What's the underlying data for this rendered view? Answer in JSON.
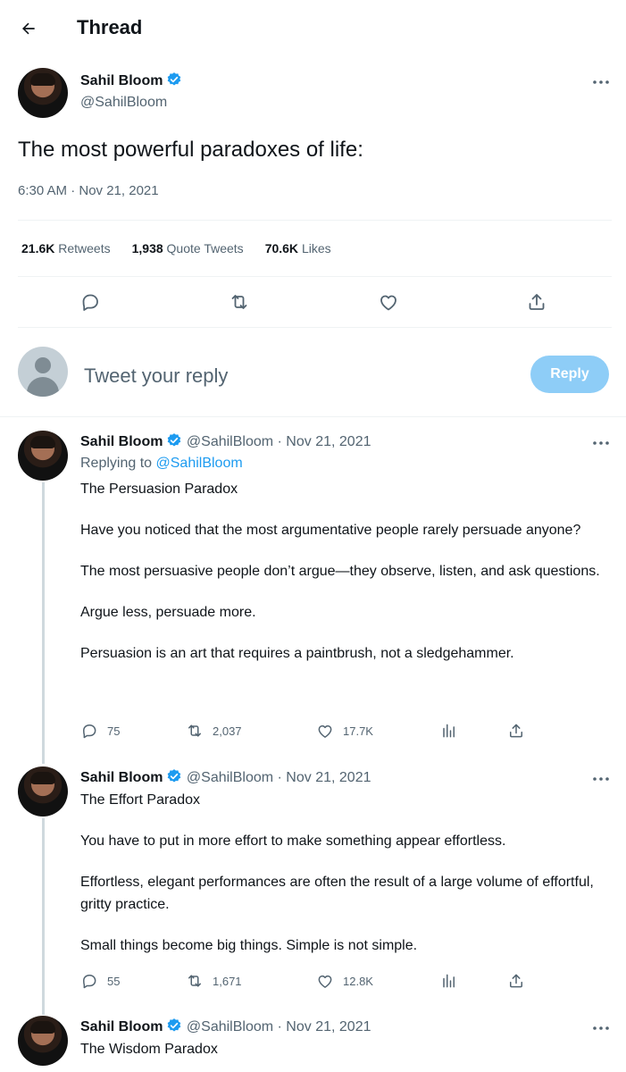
{
  "header": {
    "title": "Thread"
  },
  "main_tweet": {
    "author_name": "Sahil Bloom",
    "handle": "@SahilBloom",
    "text": "The most powerful paradoxes of life:",
    "timestamp": "6:30 AM · Nov 21, 2021",
    "stats": {
      "retweets_value": "21.6K",
      "retweets_label": "Retweets",
      "quotes_value": "1,938",
      "quotes_label": "Quote Tweets",
      "likes_value": "70.6K",
      "likes_label": "Likes"
    }
  },
  "composer": {
    "placeholder": "Tweet your reply",
    "button_label": "Reply"
  },
  "thread": [
    {
      "author_name": "Sahil Bloom",
      "handle": "@SahilBloom",
      "date": "· Nov 21, 2021",
      "replying_prefix": "Replying to",
      "replying_handle": "@SahilBloom",
      "paragraphs": [
        "The Persuasion Paradox",
        "Have you noticed that the most argumentative people rarely persuade anyone?",
        "The most persuasive people don’t argue—they observe, listen, and ask questions.",
        "Argue less, persuade more.",
        "Persuasion is an art that requires a paintbrush, not a sledgehammer."
      ],
      "replies": "75",
      "retweets": "2,037",
      "likes": "17.7K"
    },
    {
      "author_name": "Sahil Bloom",
      "handle": "@SahilBloom",
      "date": "· Nov 21, 2021",
      "paragraphs": [
        "The Effort Paradox",
        "You have to put in more effort to make something appear effortless.",
        "Effortless, elegant performances are often the result of a large volume of effortful, gritty practice.",
        "Small things become big things. Simple is not simple."
      ],
      "replies": "55",
      "retweets": "1,671",
      "likes": "12.8K"
    },
    {
      "author_name": "Sahil Bloom",
      "handle": "@SahilBloom",
      "date": "· Nov 21, 2021",
      "paragraphs": [
        "The Wisdom Paradox"
      ]
    }
  ],
  "colors": {
    "accent": "#1d9bf0",
    "reply_button_disabled": "#8ecdf7",
    "muted_text": "#536471",
    "thread_line": "#cfd9de"
  }
}
